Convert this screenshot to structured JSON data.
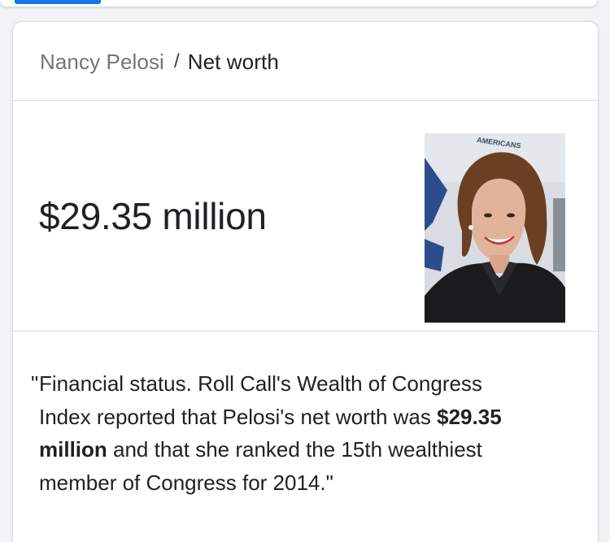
{
  "breadcrumb": {
    "entity": "Nancy Pelosi",
    "separator": "/",
    "attribute": "Net worth"
  },
  "answer": {
    "value": "$29.35 million"
  },
  "portrait": {
    "sign_text": "AMERICANS",
    "background_color": "#d9dde3",
    "accent_color": "#2c4c8c"
  },
  "snippet": {
    "open_quote": "\"",
    "line1": "Financial status. Roll Call's Wealth of Congress",
    "line2_pre": "Index reported that Pelosi's net worth was ",
    "line2_bold": "$29.35",
    "line3_bold": "million",
    "line3_post": " and that she ranked the 15th wealthiest",
    "line4": "member of Congress for 2014.",
    "close_quote": "\""
  },
  "colors": {
    "accent_blue": "#1a73e8",
    "text_primary": "#202124",
    "text_secondary": "#70757a",
    "divider": "#dadce0"
  }
}
